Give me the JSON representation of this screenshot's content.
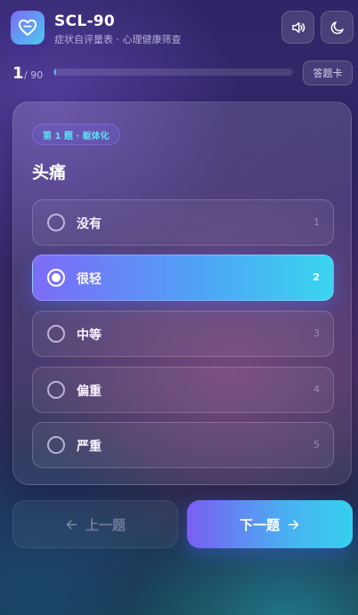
{
  "header": {
    "title": "SCL-90",
    "subtitle": "症状自评量表 · 心理健康筛查",
    "logo_icon": "heart-icon",
    "sound_icon": "speaker-icon",
    "theme_icon": "moon-icon"
  },
  "progress": {
    "current": "1",
    "total": "/ 90",
    "fraction": 0.0111,
    "answer_card_label": "答题卡"
  },
  "question": {
    "badge": "第 1 题 · 躯体化",
    "text": "头痛",
    "selected_index": 1,
    "options": [
      {
        "label": "没有",
        "value": "1"
      },
      {
        "label": "很轻",
        "value": "2"
      },
      {
        "label": "中等",
        "value": "3"
      },
      {
        "label": "偏重",
        "value": "4"
      },
      {
        "label": "严重",
        "value": "5"
      }
    ]
  },
  "nav": {
    "prev_label": "上一题",
    "next_label": "下一题",
    "prev_icon": "arrow-left-icon",
    "next_icon": "arrow-right-icon"
  },
  "colors": {
    "accent_start": "#7a6df5",
    "accent_end": "#3ad6ef",
    "badge_text": "#5ee0f2"
  }
}
